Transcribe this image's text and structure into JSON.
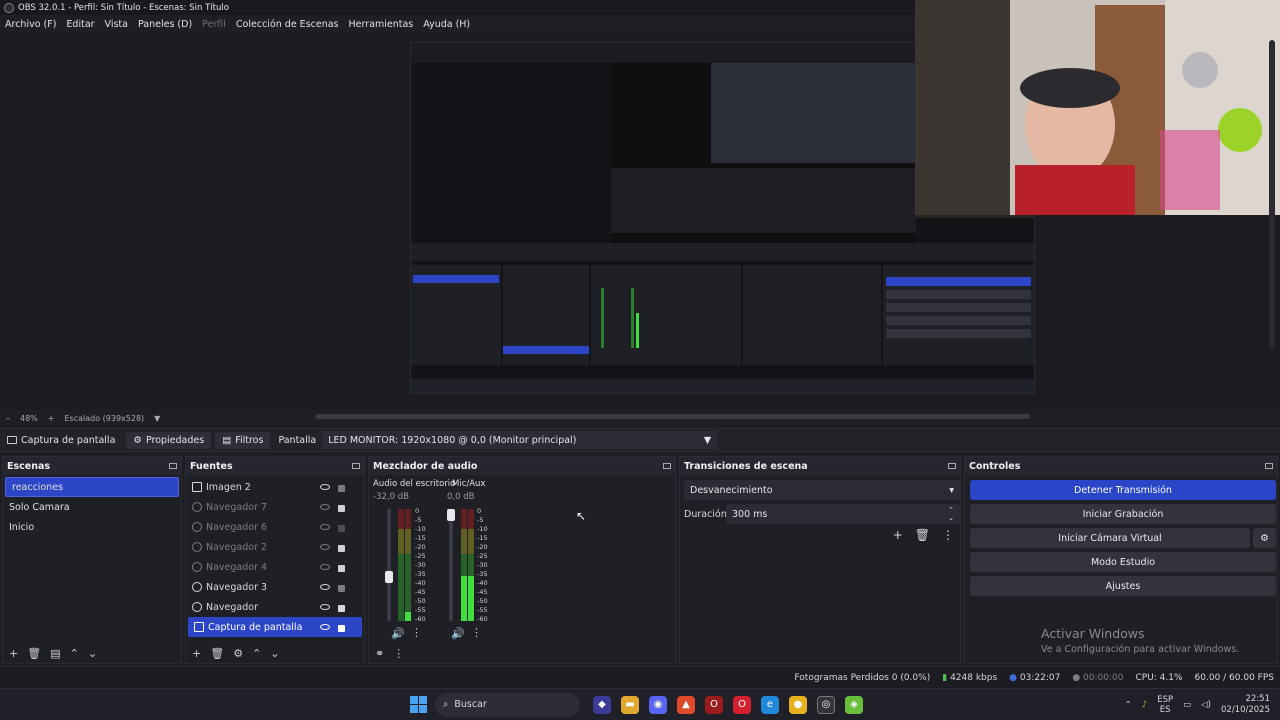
{
  "window": {
    "title": "OBS 32.0.1 - Perfil: Sin Título - Escenas: Sin Título"
  },
  "menu": [
    {
      "label": "Archivo (F)",
      "disabled": false
    },
    {
      "label": "Editar",
      "disabled": false
    },
    {
      "label": "Vista",
      "disabled": false
    },
    {
      "label": "Paneles (D)",
      "disabled": false
    },
    {
      "label": "Perfil",
      "disabled": true
    },
    {
      "label": "Colección de Escenas",
      "disabled": false
    },
    {
      "label": "Herramientas",
      "disabled": false
    },
    {
      "label": "Ayuda (H)",
      "disabled": false
    }
  ],
  "zoom": {
    "minus": "–",
    "level": "48%",
    "plus": "+",
    "scaling": "Escalado (939x528)"
  },
  "sourcebar": {
    "source_name": "Captura de pantalla",
    "properties": "Propiedades",
    "filters": "Filtros",
    "display_label": "Pantalla",
    "display_value": "LED MONITOR: 1920x1080 @ 0,0 (Monitor principal)"
  },
  "scenes": {
    "title": "Escenas",
    "items": [
      {
        "label": "reacciones",
        "selected": true
      },
      {
        "label": "Solo Camara",
        "selected": false
      },
      {
        "label": "Inicio",
        "selected": false
      }
    ]
  },
  "sources": {
    "title": "Fuentes",
    "items": [
      {
        "label": "Imagen 2",
        "visible": true,
        "type": "image"
      },
      {
        "label": "Navegador 7",
        "visible": false,
        "type": "browser"
      },
      {
        "label": "Navegador 6",
        "visible": false,
        "type": "browser"
      },
      {
        "label": "Navegador 2",
        "visible": false,
        "type": "browser"
      },
      {
        "label": "Navegador 4",
        "visible": false,
        "type": "browser"
      },
      {
        "label": "Navegador 3",
        "visible": true,
        "type": "browser"
      },
      {
        "label": "Navegador",
        "visible": true,
        "type": "browser"
      },
      {
        "label": "Captura de pantalla",
        "visible": true,
        "type": "display",
        "selected": true
      }
    ]
  },
  "mixer": {
    "title": "Mezclador de audio",
    "channels": [
      {
        "name": "Audio del escritorio",
        "db": "-32,0 dB",
        "level": 0.08,
        "fader": 0.45
      },
      {
        "name": "Mic/Aux",
        "db": "0,0 dB",
        "level": 0.4,
        "fader": 0.95
      }
    ],
    "scale": [
      "0",
      "-5",
      "-10",
      "-15",
      "-20",
      "-25",
      "-30",
      "-35",
      "-40",
      "-45",
      "-50",
      "-55",
      "-60"
    ]
  },
  "transitions": {
    "title": "Transiciones de escena",
    "selected": "Desvanecimiento",
    "duration_label": "Duración",
    "duration_value": "300 ms"
  },
  "controls": {
    "title": "Controles",
    "stop_stream": "Detener Transmisión",
    "start_recording": "Iniciar Grabación",
    "virtual_camera": "Iniciar Cámara Virtual",
    "studio_mode": "Modo Estudio",
    "settings": "Ajustes"
  },
  "watermark": {
    "title": "Activar Windows",
    "subtitle": "Ve a Configuración para activar Windows."
  },
  "status": {
    "dropped": "Fotogramas Perdidos 0 (0.0%)",
    "bitrate": "4248 kbps",
    "stream_time": "03:22:07",
    "rec_time": "00:00:00",
    "cpu": "CPU: 4.1%",
    "fps": "60.00 / 60.00 FPS"
  },
  "taskbar": {
    "search": "Buscar",
    "lang_top": "ESP",
    "lang_bottom": "ES",
    "time": "22:51",
    "date": "02/10/2025"
  },
  "colors": {
    "accent": "#2d46c8",
    "panel": "#1f1f26",
    "background": "#1e1e24"
  }
}
